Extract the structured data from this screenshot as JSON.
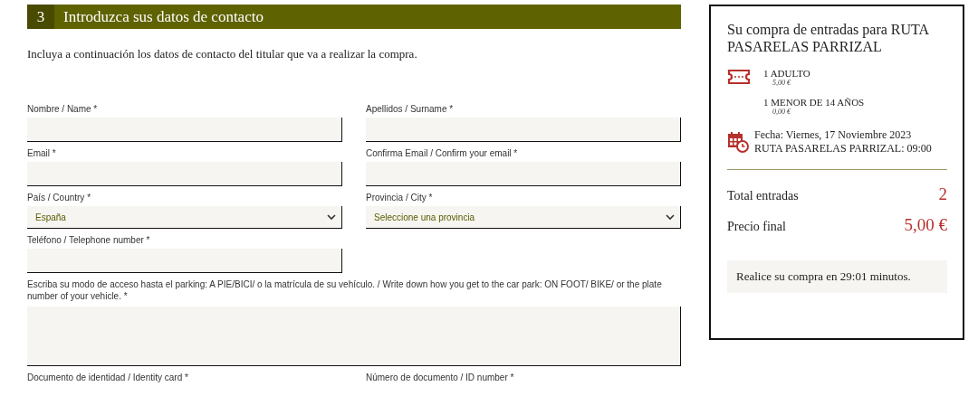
{
  "section": {
    "number": "3",
    "title": "Introduzca sus datos de contacto"
  },
  "intro": "Incluya a continuación los datos de contacto del titular que va a realizar la compra.",
  "rows": [
    [
      {
        "label": "Nombre / Name *",
        "kind": "text"
      },
      {
        "label": "Apellidos / Surname *",
        "kind": "text"
      }
    ],
    [
      {
        "label": "Email *",
        "kind": "text"
      },
      {
        "label": "Confirma Email / Confirm your email *",
        "kind": "text"
      }
    ],
    [
      {
        "label": "País / Country *",
        "kind": "select",
        "value": "España"
      },
      {
        "label": "Provincia / City *",
        "kind": "select",
        "value": "Seleccione una provincia"
      }
    ],
    [
      {
        "label": "Teléfono / Telephone number *",
        "kind": "text"
      }
    ],
    [
      {
        "label": "Escriba su modo de acceso hasta el parking: A PIE/BICI/ o la matrícula de su vehículo. / Write down how you get to the car park: ON FOOT/ BIKE/ or the plate number of your vehicle. *",
        "kind": "textarea"
      }
    ],
    [
      {
        "label": "Documento de identidad / Identity card *",
        "kind": "label"
      },
      {
        "label": "Número de documento / ID number *",
        "kind": "label"
      }
    ]
  ],
  "summary": {
    "title": "Su compra de entradas para RUTA PASARELAS PARRIZAL",
    "tickets": [
      {
        "name": "1 ADULTO",
        "price": "5,00 €"
      },
      {
        "name": "1 MENOR DE 14 AÑOS",
        "price": "0,00 €"
      }
    ],
    "date": "Fecha: Viernes, 17 Noviembre 2023",
    "session": "RUTA PASARELAS PARRIZAL: 09:00",
    "totals": [
      {
        "label": "Total entradas",
        "value": "2"
      },
      {
        "label": "Precio final",
        "value": "5,00 €"
      }
    ],
    "timer": "Realice su compra en 29:01 minutos."
  }
}
